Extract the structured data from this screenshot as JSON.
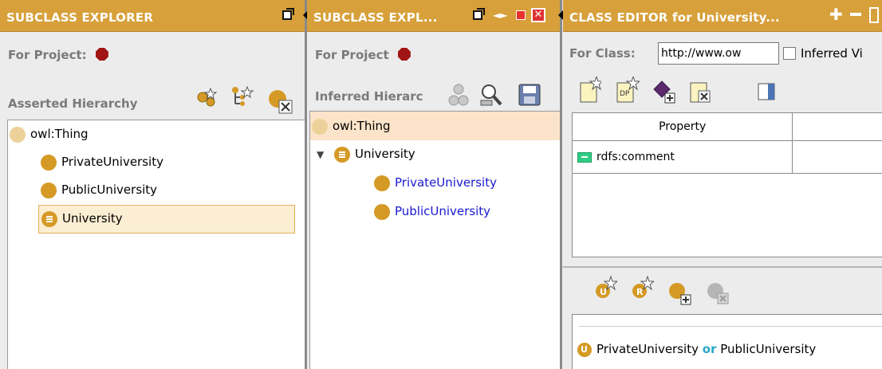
{
  "panel1": {
    "title": "SUBCLASS EXPLORER",
    "for_project_label": "For Project:",
    "hierarchy_label": "Asserted Hierarchy",
    "tree": {
      "root": "owl:Thing",
      "children": [
        "PrivateUniversity",
        "PublicUniversity",
        "University"
      ]
    }
  },
  "panel2": {
    "title": "SUBCLASS EXPL...",
    "for_project_label": "For Project",
    "hierarchy_label": "Inferred Hierarc",
    "tree": {
      "root": "owl:Thing",
      "child": "University",
      "grandchildren": [
        "PrivateUniversity",
        "PublicUniversity"
      ]
    }
  },
  "panel3": {
    "title": "CLASS EDITOR for University...",
    "for_class_label": "For Class:",
    "for_class_value": "http://www.ow",
    "inferred_label": "Inferred Vi",
    "table": {
      "column": "Property",
      "rows": [
        {
          "name": "rdfs:comment"
        }
      ]
    },
    "condition": {
      "left": "PrivateUniversity",
      "op": "or",
      "right": "PublicUniversity"
    }
  },
  "colors": {
    "titlebar": "#d7a03a",
    "class_dot": "#d59a26",
    "project_hex": "#a11515",
    "link_blue": "#1a1ad0",
    "or_cyan": "#2aa7c9"
  }
}
